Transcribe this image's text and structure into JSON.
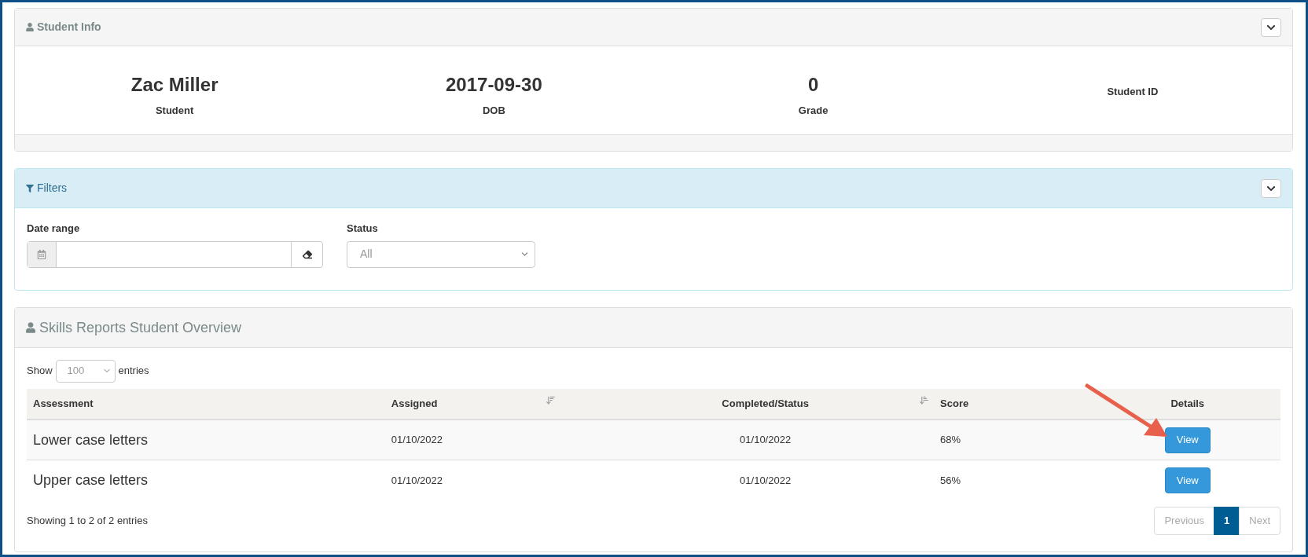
{
  "student_info": {
    "title": "Student Info",
    "expanded": true,
    "stats": [
      {
        "value": "Zac Miller",
        "label": "Student"
      },
      {
        "value": "2017-09-30",
        "label": "DOB"
      },
      {
        "value": "0",
        "label": "Grade"
      },
      {
        "label": "Student ID"
      }
    ]
  },
  "filters": {
    "title": "Filters",
    "expanded": true,
    "date_range": {
      "label": "Date range"
    },
    "status": {
      "label": "Status",
      "placeholder": "All"
    }
  },
  "overview": {
    "title": "Skills Reports Student Overview",
    "show_label": "Show",
    "page_size": "100",
    "entries_label": "entries",
    "columns": [
      {
        "label": "Assessment",
        "kind": "plain"
      },
      {
        "label": "Assigned",
        "kind": "sort-desc"
      },
      {
        "label": "Completed/Status",
        "kind": "sort-asc"
      },
      {
        "label": "Score",
        "kind": "plain"
      },
      {
        "label": "Details",
        "kind": "plain"
      }
    ],
    "rows": [
      {
        "assessment": "Lower case letters",
        "assigned": "01/10/2022",
        "completed": "01/10/2022",
        "score": "68%",
        "button": "View"
      },
      {
        "assessment": "Upper case letters",
        "assigned": "01/10/2022",
        "completed": "01/10/2022",
        "score": "56%",
        "button": "View"
      }
    ],
    "info": "Showing 1 to 2 of 2 entries",
    "pagination": [
      {
        "label": "Previous",
        "selected": false,
        "disabled": true
      },
      {
        "label": "1",
        "selected": true,
        "disabled": false
      },
      {
        "label": "Next",
        "selected": false,
        "disabled": true
      }
    ]
  }
}
